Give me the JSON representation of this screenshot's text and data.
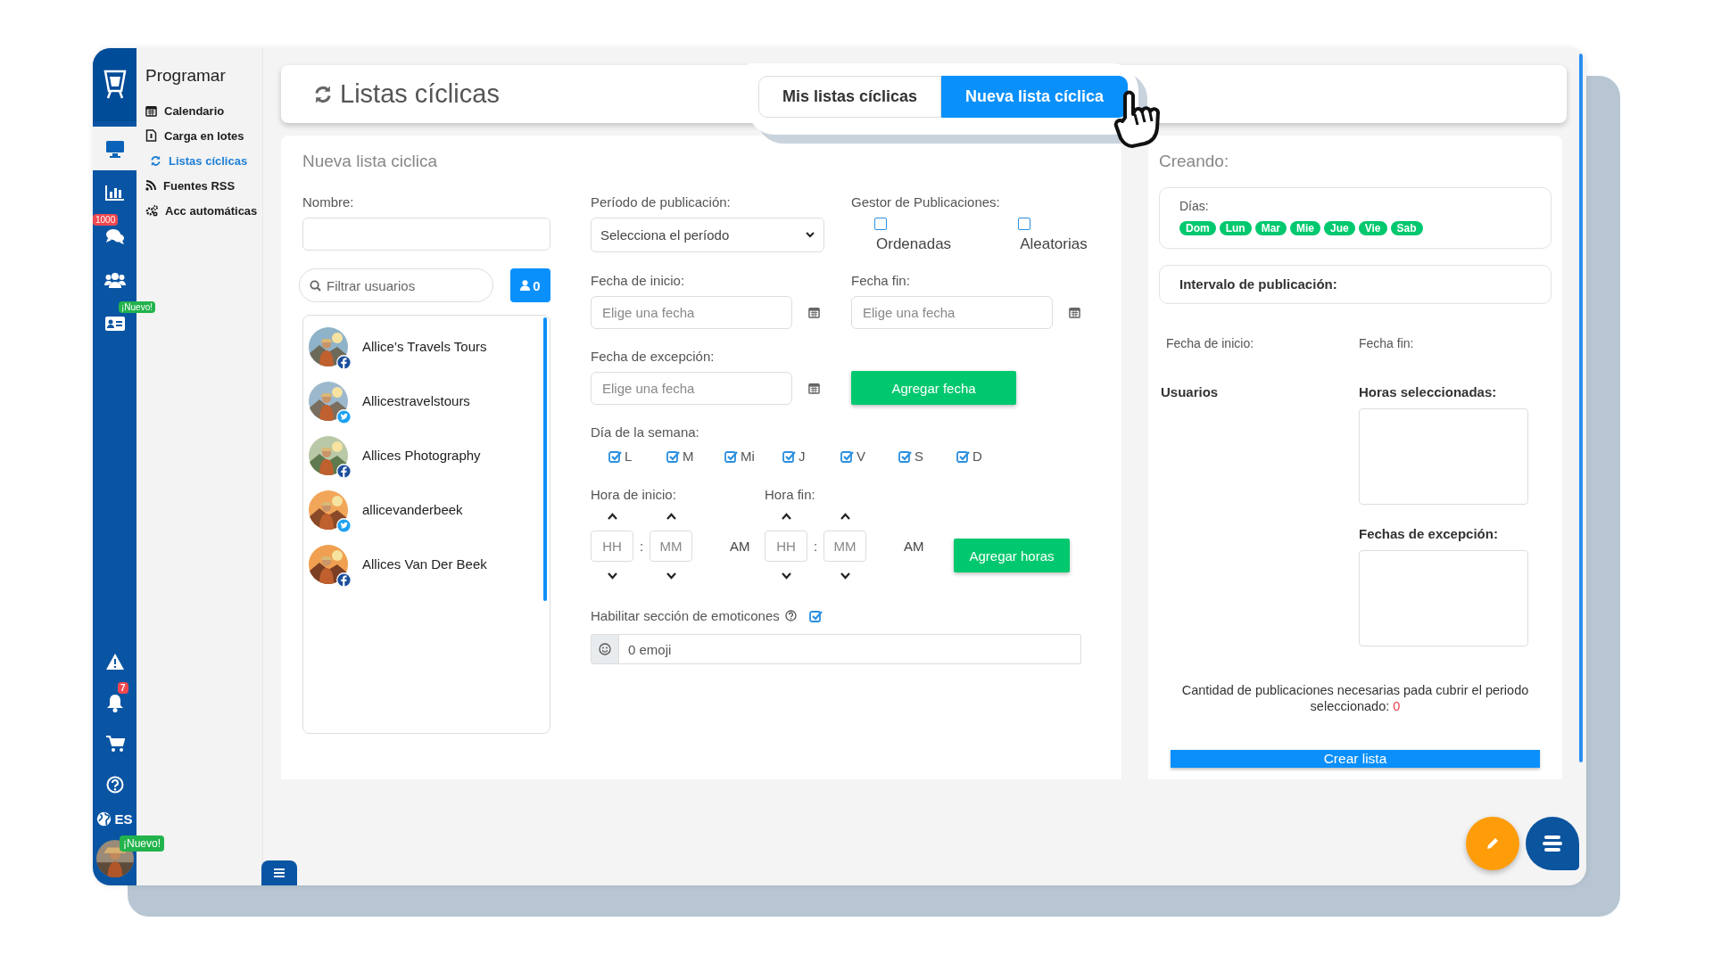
{
  "sidebar_rail": {
    "top": [
      {
        "selected": true
      },
      {
        "selected": false
      },
      {
        "selected": false,
        "badge": {
          "text": "1000",
          "color": "#f0484f"
        }
      },
      {
        "selected": false
      },
      {
        "selected": false,
        "badge": {
          "text": "¡Nuevo!",
          "color": "#22b34c"
        }
      }
    ],
    "alert_badge": "7",
    "language": "ES",
    "profile_badge": "¡Nuevo!"
  },
  "submenu": {
    "title": "Programar",
    "items": [
      {
        "label": "Calendario",
        "selected": false
      },
      {
        "label": "Carga en lotes",
        "selected": false
      },
      {
        "label": "Listas cíclicas",
        "selected": true
      },
      {
        "label": "Fuentes RSS",
        "selected": false
      },
      {
        "label": "Acc automáticas",
        "selected": false
      }
    ]
  },
  "header": {
    "title": "Listas cíclicas",
    "tabs": [
      {
        "label": "Mis listas cíclicas",
        "selected": false
      },
      {
        "label": "Nueva lista cíclica",
        "selected": true
      }
    ]
  },
  "form": {
    "title": "Nueva lista ciclica",
    "name_label": "Nombre:",
    "user_filter": {
      "placeholder": "Filtrar usuarios"
    },
    "user_count": "0",
    "users": [
      {
        "name": "Allice’s Travels Tours",
        "kind": "facebook"
      },
      {
        "name": "Allicestravelstours",
        "kind": "twitter"
      },
      {
        "name": "Allices Photography",
        "kind": "facebook"
      },
      {
        "name": "allicevanderbeek",
        "kind": "twitter"
      },
      {
        "name": "Allices Van Der Beek",
        "kind": "facebook"
      }
    ],
    "period": {
      "label": "Período de publicación:",
      "value": "Selecciona el período"
    },
    "manager": {
      "label": "Gestor de Publicaciones:",
      "options": [
        {
          "label": "Ordenadas",
          "checked": false
        },
        {
          "label": "Aleatorias",
          "checked": false
        }
      ]
    },
    "start_date": {
      "label": "Fecha de inicio:",
      "placeholder": "Elige una fecha"
    },
    "end_date": {
      "label": "Fecha fin:",
      "placeholder": "Elige una fecha"
    },
    "exception_date": {
      "label": "Fecha de excepción:",
      "placeholder": "Elige una fecha"
    },
    "add_date_button": "Agregar fecha",
    "weekdays": {
      "label": "Día de la semana:",
      "days": [
        {
          "label": "L",
          "checked": true
        },
        {
          "label": "M",
          "checked": true
        },
        {
          "label": "Mi",
          "checked": true
        },
        {
          "label": "J",
          "checked": true
        },
        {
          "label": "V",
          "checked": true
        },
        {
          "label": "S",
          "checked": true
        },
        {
          "label": "D",
          "checked": true
        }
      ]
    },
    "times": [
      {
        "label": "Hora de inicio:",
        "hour_placeholder": "HH",
        "minute_placeholder": "MM",
        "separator": ":",
        "period": "AM"
      },
      {
        "label": "Hora fin:",
        "hour_placeholder": "HH",
        "minute_placeholder": "MM",
        "separator": ":",
        "period": "AM"
      }
    ],
    "add_hours_button": "Agregar horas",
    "emoticons": {
      "label": "Habilitar sección de emoticones",
      "checked": true,
      "value": "0 emoji"
    }
  },
  "summary": {
    "title": "Creando:",
    "days_label": "Días:",
    "days": [
      "Dom",
      "Lun",
      "Mar",
      "Mie",
      "Jue",
      "Vie",
      "Sab"
    ],
    "interval_label": "Intervalo de publicación:",
    "start_label": "Fecha de inicio:",
    "end_label": "Fecha fin:",
    "users_label": "Usuarios",
    "hours_label": "Horas seleccionadas:",
    "exceptions_label": "Fechas de excepción:",
    "count_text": "Cantidad de publicaciones necesarias pada cubrir el periodo seleccionado:",
    "count": "0",
    "create_button": "Crear lista"
  }
}
